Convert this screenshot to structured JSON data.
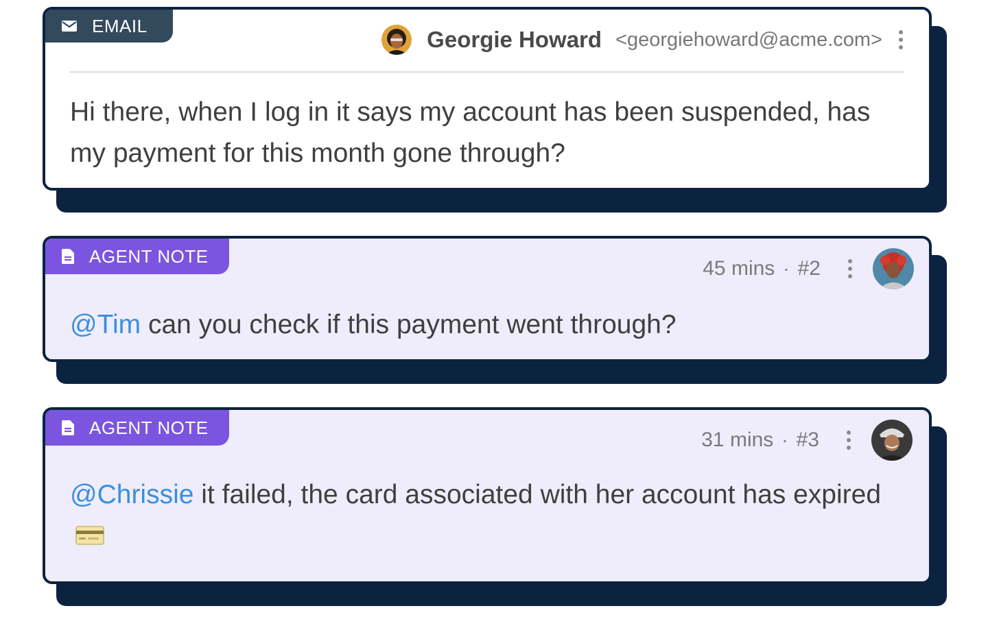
{
  "email": {
    "tag_label": "EMAIL",
    "tag_icon": "envelope-icon",
    "sender_name": "Georgie Howard",
    "sender_email": "<georgiehoward@acme.com>",
    "message": "Hi there, when I log in it says my account has been suspended, has my payment for this month gone through?"
  },
  "notes": [
    {
      "tag_label": "AGENT NOTE",
      "tag_icon": "document-icon",
      "time": "45 mins",
      "separator": "·",
      "number": "#2",
      "mention": "@Tim",
      "message": " can you check if this payment went through?"
    },
    {
      "tag_label": "AGENT NOTE",
      "tag_icon": "document-icon",
      "time": "31 mins",
      "separator": "·",
      "number": "#3",
      "mention": "@Chrissie",
      "message": " it failed, the card associated with her account has expired"
    }
  ],
  "colors": {
    "navy": "#0c2340",
    "email_tag": "#33495c",
    "note_tag": "#7b55e0",
    "note_bg": "#efedfb",
    "mention": "#3b8ee0"
  }
}
